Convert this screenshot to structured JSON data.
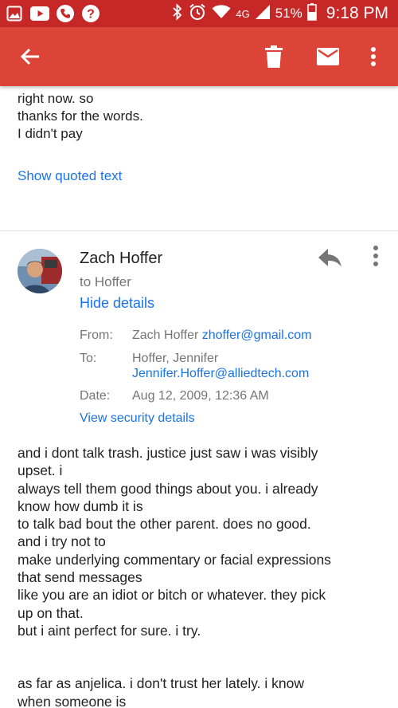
{
  "status_bar": {
    "battery": "51%",
    "network": "4G",
    "time": "9:18 PM",
    "color": "#c62828"
  },
  "app_bar": {
    "color": "#db4437",
    "back_icon": "arrow-left-icon",
    "delete_icon": "trash-icon",
    "mail_icon": "envelope-icon",
    "more_icon": "more-vert-icon"
  },
  "previous_message": {
    "lines": [
      "right now. so",
      "thanks for the words.",
      "I didn't pay"
    ],
    "show_quoted": "Show quoted text"
  },
  "message": {
    "sender": "Zach Hoffer",
    "to_line": "to Hoffer",
    "hide_details": "Hide details",
    "details": {
      "from_label": "From:",
      "from_name": "Zach Hoffer",
      "from_email": "zhoffer@gmail.com",
      "to_label": "To:",
      "to_name": "Hoffer, Jennifer",
      "to_email": "Jennifer.Hoffer@alliedtech.com",
      "date_label": "Date:",
      "date_value": "Aug 12, 2009, 12:36 AM"
    },
    "security": "View security details",
    "body_lines": [
      "and i dont talk trash.  justice just saw i was visibly",
      "upset.  i",
      "always tell them good things about you.  i already",
      "know how dumb it is",
      "to talk bad bout the other parent.  does no good.",
      "and i try not to",
      "make underlying commentary or facial expressions",
      "that send messages",
      "like you are an idiot or bitch or whatever.  they pick",
      "up on that.",
      "but i aint perfect for sure. i try.",
      "",
      "as far as anjelica.  i don't trust her lately.  i know",
      "when someone is"
    ]
  }
}
